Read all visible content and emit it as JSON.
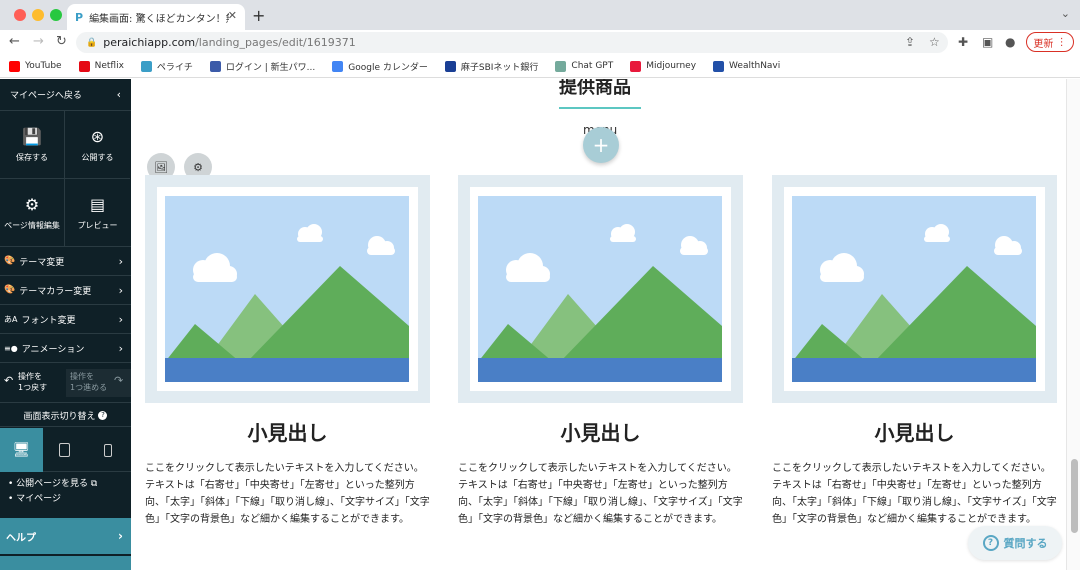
{
  "browser": {
    "tab_title": "編集画面: 驚くほどカンタン！無料",
    "url_host": "peraichiapp.com",
    "url_path": "/landing_pages/edit/1619371",
    "update_label": "更新",
    "new_tab_symbol": "+",
    "close_symbol": "✕",
    "colors": {
      "tabbar": "#dee1e6",
      "update": "#d93025"
    }
  },
  "bookmarks": [
    {
      "label": "YouTube",
      "icon": "youtube-icon",
      "color": "#ff0000"
    },
    {
      "label": "Netflix",
      "icon": "netflix-icon",
      "color": "#e50914"
    },
    {
      "label": "ペライチ",
      "icon": "peraichi-icon",
      "color": "#3b9ec7"
    },
    {
      "label": "ログイン | 新生パワ...",
      "icon": "shinsei-icon",
      "color": "#3c5ba9"
    },
    {
      "label": "Google カレンダー",
      "icon": "google-calendar-icon",
      "color": "#4285f4"
    },
    {
      "label": "麻子SBIネット銀行",
      "icon": "sbi-icon",
      "color": "#1a3f95"
    },
    {
      "label": "Chat GPT",
      "icon": "chatgpt-icon",
      "color": "#74aa9c"
    },
    {
      "label": "Midjourney",
      "icon": "midjourney-icon",
      "color": "#e8193c"
    },
    {
      "label": "WealthNavi",
      "icon": "wealthnavi-icon",
      "color": "#2250a8"
    }
  ],
  "sidebar": {
    "back_label": "マイページへ戻る",
    "grid": [
      {
        "label": "保存する",
        "icon": "save-icon"
      },
      {
        "label": "公開する",
        "icon": "publish-icon"
      },
      {
        "label": "ページ情報編集",
        "icon": "gear-icon"
      },
      {
        "label": "プレビュー",
        "icon": "preview-icon"
      }
    ],
    "menu": [
      {
        "label": "テーマ変更",
        "icon": "palette-icon"
      },
      {
        "label": "テーマカラー変更",
        "icon": "palette-icon"
      },
      {
        "label": "フォント変更",
        "icon": "font-icon"
      },
      {
        "label": "アニメーション",
        "icon": "animation-icon"
      }
    ],
    "undo": "操作を\n1つ戻す",
    "redo": "操作を\n1つ進める",
    "switch_label": "画面表示切り替え",
    "links": [
      "公開ページを見る",
      "マイページ"
    ],
    "help_label": "ヘルプ",
    "colors": {
      "bg": "#0f2027",
      "active": "#3a8ea0"
    }
  },
  "main": {
    "section_title": "提供商品",
    "menu_label": "menu",
    "add_symbol": "+",
    "cards": [
      {
        "heading": "小見出し",
        "text": "ここをクリックして表示したいテキストを入力してください。テキストは「右寄せ」「中央寄せ」「左寄せ」といった整列方向、「太字」「斜体」「下線」「取り消し線」、「文字サイズ」「文字色」「文字の背景色」など細かく編集することができます。"
      },
      {
        "heading": "小見出し",
        "text": "ここをクリックして表示したいテキストを入力してください。テキストは「右寄せ」「中央寄せ」「左寄せ」といった整列方向、「太字」「斜体」「下線」「取り消し線」、「文字サイズ」「文字色」「文字の背景色」など細かく編集することができます。"
      },
      {
        "heading": "小見出し",
        "text": "ここをクリックして表示したいテキストを入力してください。テキストは「右寄せ」「中央寄せ」「左寄せ」といった整列方向、「太字」「斜体」「下線」「取り消し線」、「文字サイズ」「文字色」「文字の背景色」など細かく編集することができます。"
      }
    ],
    "colors": {
      "accent_line": "#5cc7c2",
      "card_bg": "#e1ebf1",
      "sky": "#bcdaf6",
      "mountain_dark": "#5fad5a",
      "mountain_light": "#86c17e",
      "water": "#4a7fc6"
    }
  },
  "question_button": "質問する"
}
